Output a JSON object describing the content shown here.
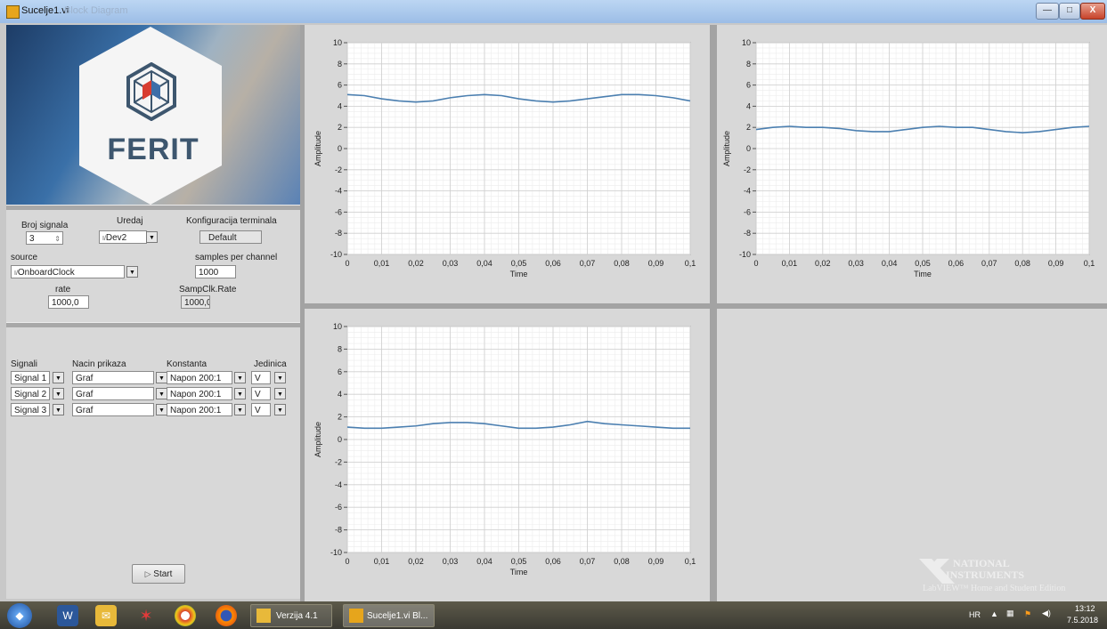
{
  "window": {
    "title": "Sucelje1.vi",
    "title_faded": "Block Diagram",
    "min_label": "—",
    "max_label": "□",
    "close_label": "X"
  },
  "logo": {
    "text": "FERIT"
  },
  "config": {
    "broj_signala": {
      "label": "Broj signala",
      "value": "3"
    },
    "uredaj": {
      "label": "Uredaj",
      "value": "Dev2",
      "prefix": "I/"
    },
    "konfiguracija": {
      "label": "Konfiguracija terminala",
      "value": "Default"
    },
    "source": {
      "label": "source",
      "value": "OnboardClock",
      "prefix": "I/"
    },
    "samples": {
      "label": "samples per channel",
      "value": "1000"
    },
    "rate": {
      "label": "rate",
      "value": "1000,0"
    },
    "sampclk": {
      "label": "SampClk.Rate",
      "value": "1000,0"
    }
  },
  "signal_table": {
    "headers": [
      "Signali",
      "Nacin prikaza",
      "Konstanta",
      "Jedinica"
    ],
    "rows": [
      {
        "signal": "Signal 1",
        "nacin": "Graf",
        "konstanta": "Napon 200:1",
        "jedinica": "V"
      },
      {
        "signal": "Signal 2",
        "nacin": "Graf",
        "konstanta": "Napon 200:1",
        "jedinica": "V"
      },
      {
        "signal": "Signal 3",
        "nacin": "Graf",
        "konstanta": "Napon 200:1",
        "jedinica": "V"
      }
    ]
  },
  "start_button": {
    "label": "Start",
    "icon": "play-triangle-icon"
  },
  "chart_data": [
    {
      "type": "line",
      "xlabel": "Time",
      "ylabel": "Amplitude",
      "xlim": [
        0,
        0.1
      ],
      "ylim": [
        -10,
        10
      ],
      "x_ticks": [
        "0",
        "0,01",
        "0,02",
        "0,03",
        "0,04",
        "0,05",
        "0,06",
        "0,07",
        "0,08",
        "0,09",
        "0,1"
      ],
      "y_ticks": [
        "10",
        "8",
        "6",
        "4",
        "2",
        "0",
        "-2",
        "-4",
        "-6",
        "-8",
        "-10"
      ],
      "grid": true,
      "series": [
        {
          "color": "#4b7fb0",
          "x": [
            0,
            0.005,
            0.01,
            0.015,
            0.02,
            0.025,
            0.03,
            0.035,
            0.04,
            0.045,
            0.05,
            0.055,
            0.06,
            0.065,
            0.07,
            0.075,
            0.08,
            0.085,
            0.09,
            0.095,
            0.1
          ],
          "y": [
            5.1,
            5.0,
            4.7,
            4.5,
            4.4,
            4.5,
            4.8,
            5.0,
            5.1,
            5.0,
            4.7,
            4.5,
            4.4,
            4.5,
            4.7,
            4.9,
            5.1,
            5.1,
            5.0,
            4.8,
            4.5
          ]
        }
      ]
    },
    {
      "type": "line",
      "xlabel": "Time",
      "ylabel": "Amplitude",
      "xlim": [
        0,
        0.1
      ],
      "ylim": [
        -10,
        10
      ],
      "x_ticks": [
        "0",
        "0,01",
        "0,02",
        "0,03",
        "0,04",
        "0,05",
        "0,06",
        "0,07",
        "0,08",
        "0,09",
        "0,1"
      ],
      "y_ticks": [
        "10",
        "8",
        "6",
        "4",
        "2",
        "0",
        "-2",
        "-4",
        "-6",
        "-8",
        "-10"
      ],
      "grid": true,
      "series": [
        {
          "color": "#4b7fb0",
          "x": [
            0,
            0.005,
            0.01,
            0.015,
            0.02,
            0.025,
            0.03,
            0.035,
            0.04,
            0.045,
            0.05,
            0.055,
            0.06,
            0.065,
            0.07,
            0.075,
            0.08,
            0.085,
            0.09,
            0.095,
            0.1
          ],
          "y": [
            1.8,
            2.0,
            2.1,
            2.0,
            2.0,
            1.9,
            1.7,
            1.6,
            1.6,
            1.8,
            2.0,
            2.1,
            2.0,
            2.0,
            1.8,
            1.6,
            1.5,
            1.6,
            1.8,
            2.0,
            2.1
          ]
        }
      ]
    },
    {
      "type": "line",
      "xlabel": "Time",
      "ylabel": "Amplitude",
      "xlim": [
        0,
        0.1
      ],
      "ylim": [
        -10,
        10
      ],
      "x_ticks": [
        "0",
        "0,01",
        "0,02",
        "0,03",
        "0,04",
        "0,05",
        "0,06",
        "0,07",
        "0,08",
        "0,09",
        "0,1"
      ],
      "y_ticks": [
        "10",
        "8",
        "6",
        "4",
        "2",
        "0",
        "-2",
        "-4",
        "-6",
        "-8",
        "-10"
      ],
      "grid": true,
      "series": [
        {
          "color": "#4b7fb0",
          "x": [
            0,
            0.005,
            0.01,
            0.015,
            0.02,
            0.025,
            0.03,
            0.035,
            0.04,
            0.045,
            0.05,
            0.055,
            0.06,
            0.065,
            0.07,
            0.075,
            0.08,
            0.085,
            0.09,
            0.095,
            0.1
          ],
          "y": [
            1.1,
            1.0,
            1.0,
            1.1,
            1.2,
            1.4,
            1.5,
            1.5,
            1.4,
            1.2,
            1.0,
            1.0,
            1.1,
            1.3,
            1.6,
            1.4,
            1.3,
            1.2,
            1.1,
            1.0,
            1.0
          ]
        }
      ]
    }
  ],
  "ni_logo": {
    "line1": "NATIONAL",
    "line2": "INSTRUMENTS",
    "line3": "LabVIEW™ Home and Student Edition"
  },
  "taskbar": {
    "tasks": [
      {
        "label": "Verzija 4.1",
        "icon": "folder-icon"
      },
      {
        "label": "Sucelje1.vi Bl...",
        "icon": "labview-icon"
      }
    ],
    "tray": {
      "lang": "HR",
      "time": "13:12",
      "date": "7.5.2018"
    }
  }
}
